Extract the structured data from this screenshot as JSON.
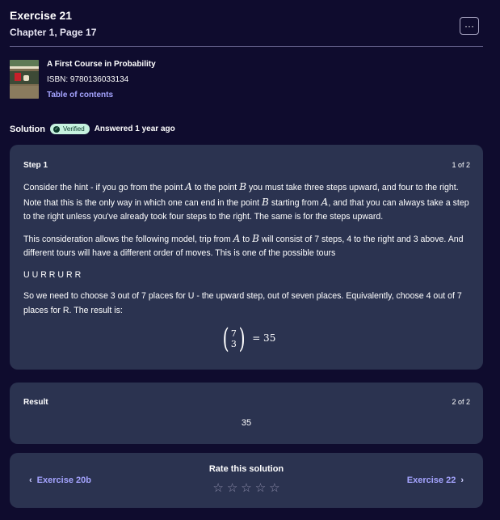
{
  "header": {
    "title": "Exercise 21",
    "subtitle": "Chapter 1, Page 17",
    "more_label": "···"
  },
  "book": {
    "title": "A First Course in Probability",
    "isbn": "ISBN: 9780136033134",
    "toc_label": "Table of contents"
  },
  "solution": {
    "label": "Solution",
    "badge": "Verified",
    "answered": "Answered 1 year ago"
  },
  "step": {
    "title": "Step 1",
    "count": "1 of 2",
    "p1_a": "Consider the hint - if you go from the point ",
    "p1_A": "A",
    "p1_b": " to the point ",
    "p1_B": "B",
    "p1_c": " you must take three steps upward, and four to the right. Note that this is the only way in which one can end in the point ",
    "p1_B2": "B",
    "p1_d": " starting from ",
    "p1_A2": "A",
    "p1_e": ", and that you can always take a step to the right unless you've already took four steps to the right. The same is for the steps upward.",
    "p2_a": "This consideration allows the following model, trip from ",
    "p2_A": "A",
    "p2_b": " to ",
    "p2_B": "B",
    "p2_c": " will consist of 7 steps, 4 to the right and 3 above. And different tours will have a different order of moves. This is one of the possible tours",
    "p3": "U U R R U R R",
    "p4": "So we need to choose 3 out of 7 places for U - the upward step, out of seven places. Equivalently, choose 4 out of 7 places for R. The result is:",
    "binom_top": "7",
    "binom_bottom": "3",
    "formula_rhs": "= 35"
  },
  "result": {
    "title": "Result",
    "count": "2 of 2",
    "value": "35"
  },
  "nav": {
    "prev": "Exercise 20b",
    "next": "Exercise 22",
    "rate_label": "Rate this solution",
    "stars": 5
  },
  "colors": {
    "background": "#0f0c2e",
    "card": "#2b3350",
    "link": "#a5a4ff",
    "verified_bg": "#c6f2df"
  }
}
